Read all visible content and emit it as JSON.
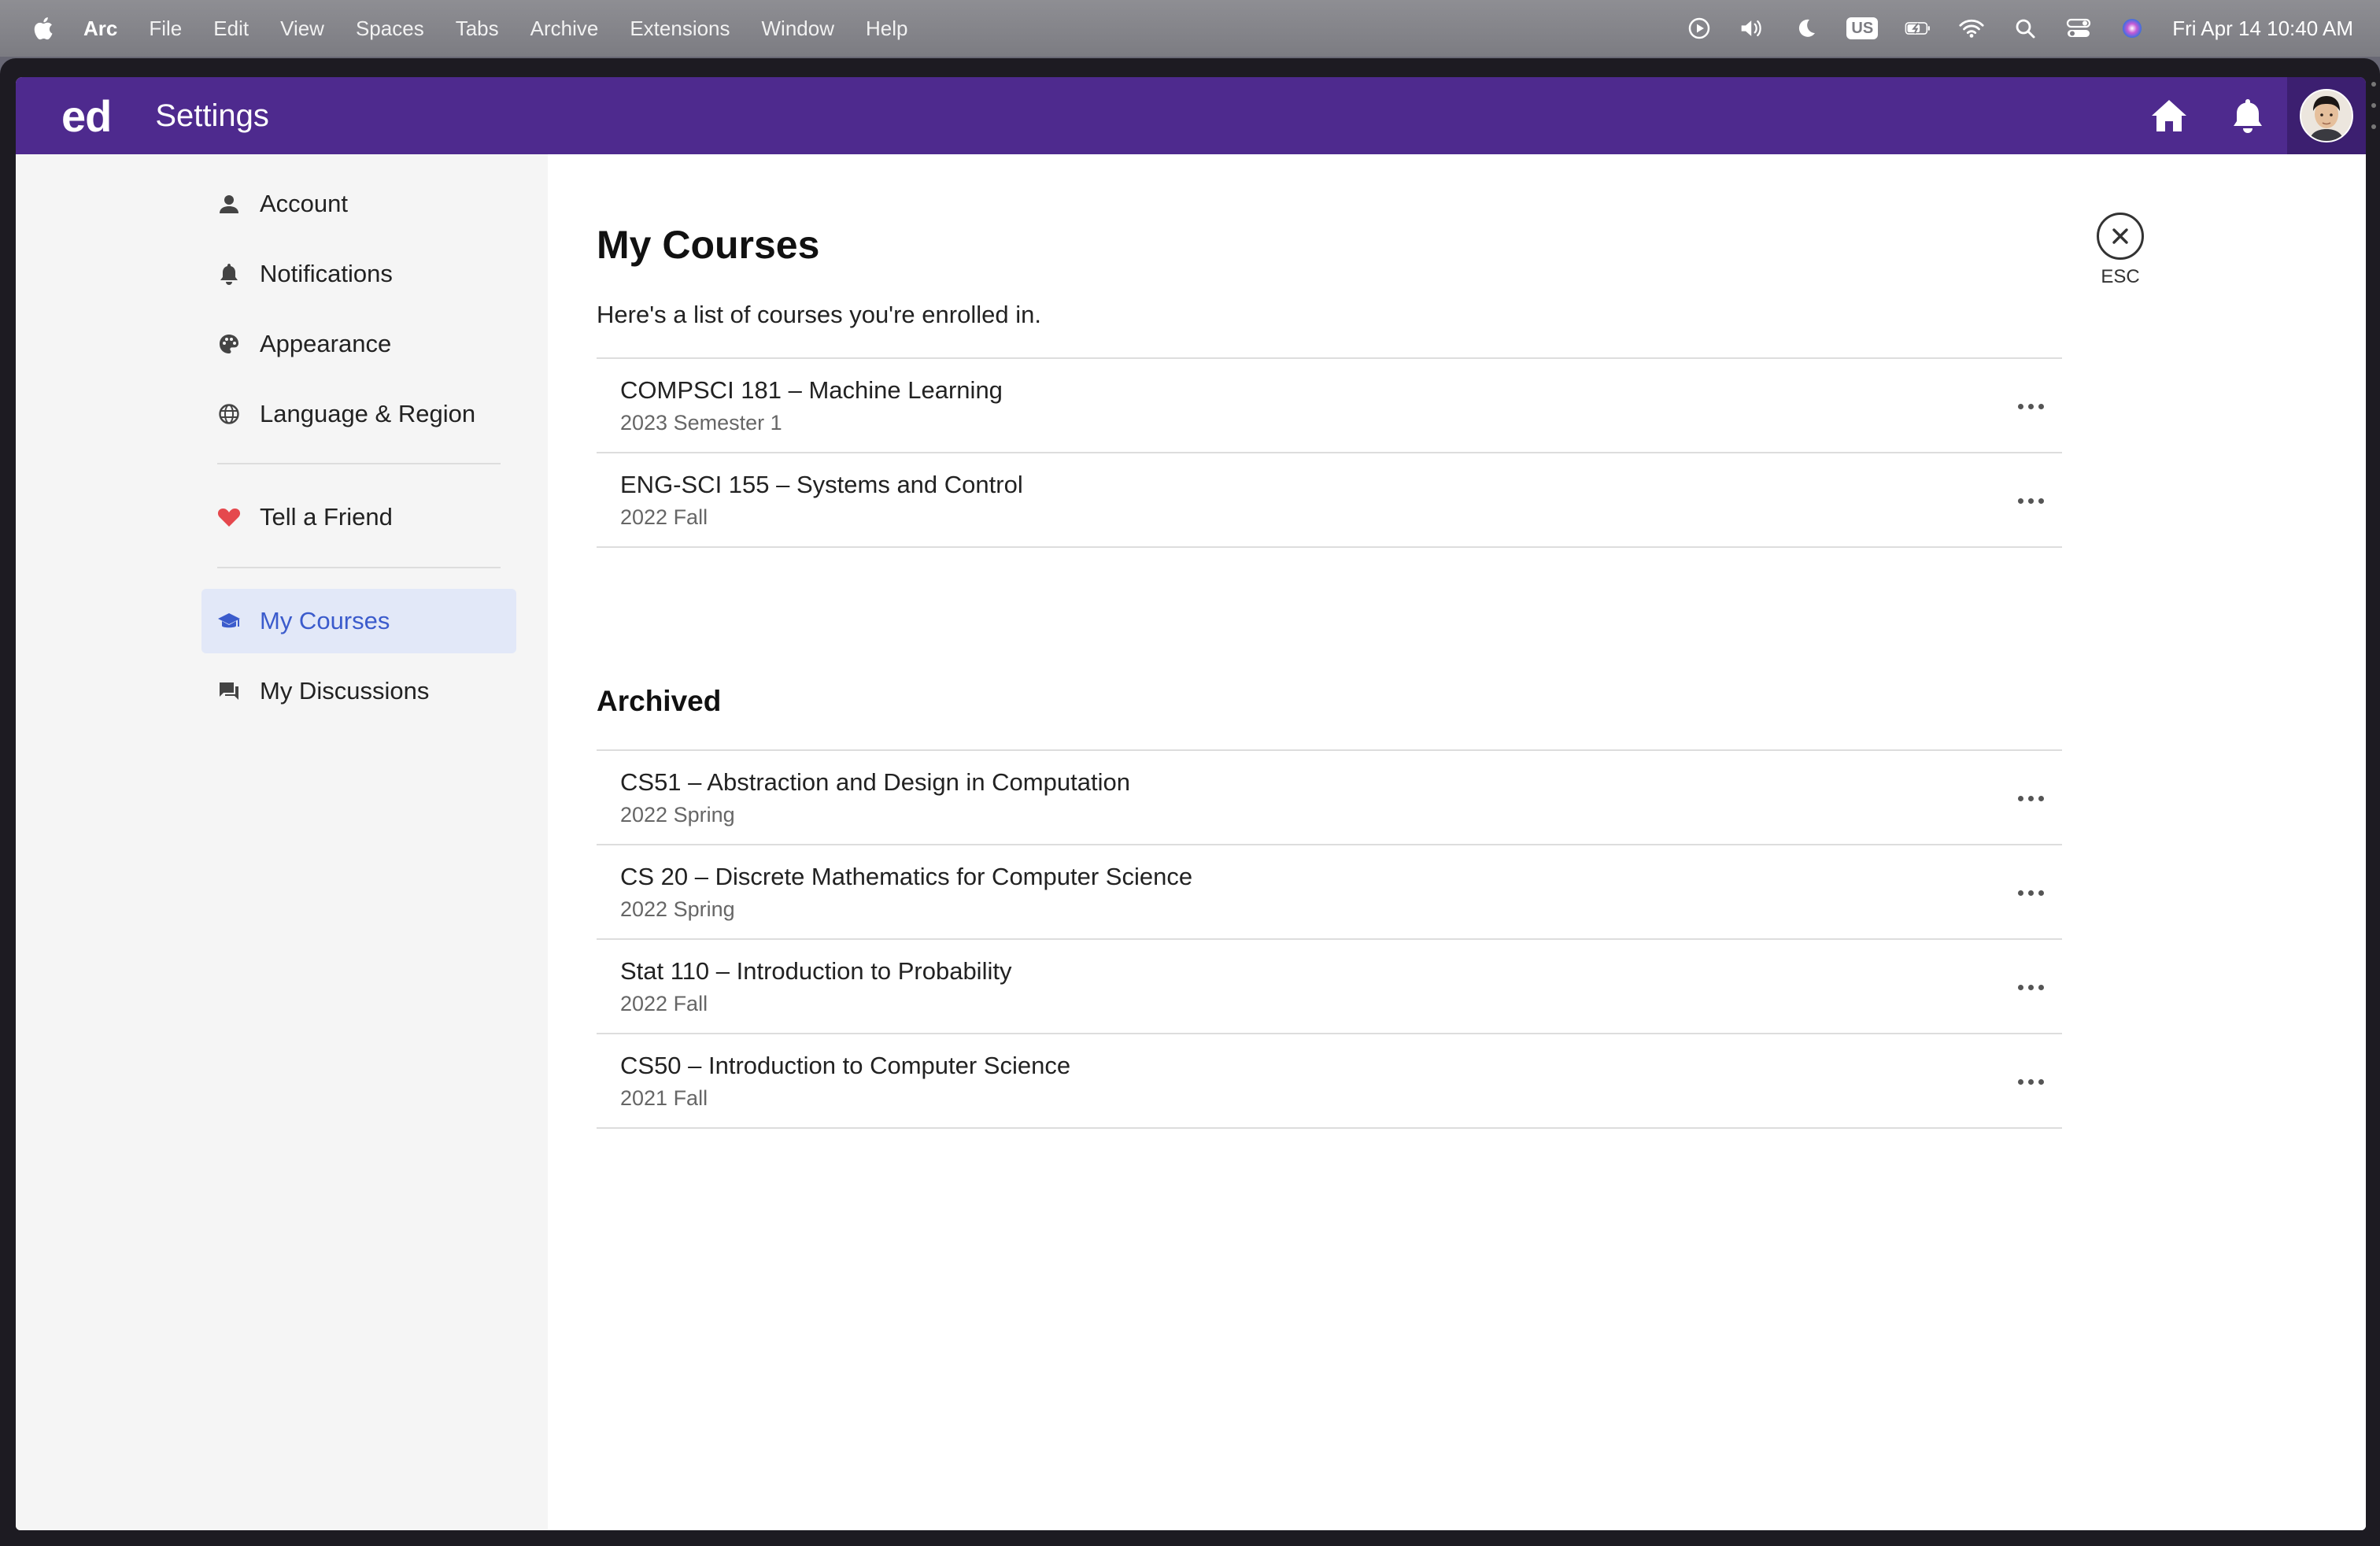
{
  "menubar": {
    "app_name": "Arc",
    "items": [
      "File",
      "Edit",
      "View",
      "Spaces",
      "Tabs",
      "Archive",
      "Extensions",
      "Window",
      "Help"
    ],
    "keyboard_layout": "US",
    "clock": "Fri Apr 14  10:40 AM",
    "status_icons": [
      "play-circle-icon",
      "volume-icon",
      "moon-icon",
      "keyboard-icon",
      "battery-icon",
      "wifi-icon",
      "search-icon",
      "control-center-icon",
      "siri-icon"
    ]
  },
  "app": {
    "logo": "ed",
    "title": "Settings",
    "brand_color": "#4e2a8e",
    "header_icons": [
      "home-icon",
      "bell-icon",
      "avatar"
    ]
  },
  "sidebar": {
    "group1": [
      {
        "label": "Account",
        "icon": "person-icon"
      },
      {
        "label": "Notifications",
        "icon": "bell-icon"
      },
      {
        "label": "Appearance",
        "icon": "palette-icon"
      },
      {
        "label": "Language & Region",
        "icon": "globe-icon"
      }
    ],
    "group2": [
      {
        "label": "Tell a Friend",
        "icon": "heart-icon"
      }
    ],
    "group3": [
      {
        "label": "My Courses",
        "icon": "graduation-cap-icon",
        "active": true
      },
      {
        "label": "My Discussions",
        "icon": "chat-icon"
      }
    ],
    "active_color": "#3b5bcc",
    "heart_color": "#e5484d"
  },
  "main": {
    "title": "My Courses",
    "subtitle": "Here's a list of courses you're enrolled in.",
    "close_label": "ESC",
    "current_courses": [
      {
        "name": "COMPSCI 181 – Machine Learning",
        "term": "2023 Semester 1"
      },
      {
        "name": "ENG-SCI 155 – Systems and Control",
        "term": "2022 Fall"
      }
    ],
    "archived_title": "Archived",
    "archived_courses": [
      {
        "name": "CS51 – Abstraction and Design in Computation",
        "term": "2022 Spring"
      },
      {
        "name": "CS 20 – Discrete Mathematics for Computer Science",
        "term": "2022 Spring"
      },
      {
        "name": "Stat 110 – Introduction to Probability",
        "term": "2022 Fall"
      },
      {
        "name": "CS50 – Introduction to Computer Science",
        "term": "2021 Fall"
      }
    ]
  }
}
